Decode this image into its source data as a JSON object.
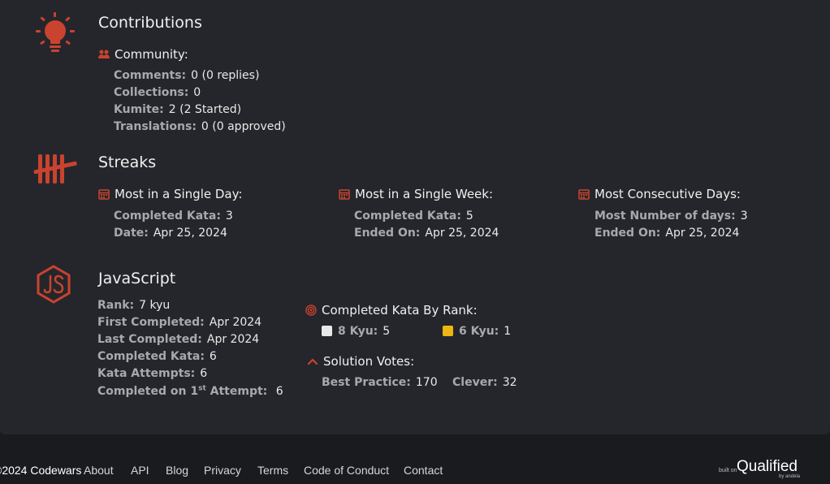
{
  "colors": {
    "accent": "#c9432f",
    "bg": "#25262b",
    "footer_bg": "#1a1b1e"
  },
  "contributions": {
    "title": "Contributions",
    "community_label": "Community:",
    "rows": [
      {
        "k": "Comments:",
        "v": "0 (0 replies)"
      },
      {
        "k": "Collections:",
        "v": "0"
      },
      {
        "k": "Kumite:",
        "v": "2 (2 Started)"
      },
      {
        "k": "Translations:",
        "v": "0 (0 approved)"
      }
    ]
  },
  "streaks": {
    "title": "Streaks",
    "day": {
      "label": "Most in a Single Day:",
      "rows": [
        {
          "k": "Completed Kata:",
          "v": "3"
        },
        {
          "k": "Date:",
          "v": "Apr 25, 2024"
        }
      ]
    },
    "week": {
      "label": "Most in a Single Week:",
      "rows": [
        {
          "k": "Completed Kata:",
          "v": "5"
        },
        {
          "k": "Ended On:",
          "v": "Apr 25, 2024"
        }
      ]
    },
    "consecutive": {
      "label": "Most Consecutive Days:",
      "rows": [
        {
          "k": "Most Number of days:",
          "v": "3"
        },
        {
          "k": "Ended On:",
          "v": "Apr 25, 2024"
        }
      ]
    }
  },
  "javascript": {
    "title": "JavaScript",
    "rows": [
      {
        "k": "Rank:",
        "v": "7 kyu"
      },
      {
        "k": "First Completed:",
        "v": "Apr 2024"
      },
      {
        "k": "Last Completed:",
        "v": "Apr 2024"
      },
      {
        "k": "Completed Kata:",
        "v": "6"
      },
      {
        "k": "Kata Attempts:",
        "v": "6"
      }
    ],
    "first_attempt": {
      "k_pre": "Completed on 1",
      "k_sup": "st",
      "k_post": " Attempt:",
      "v": "6"
    },
    "by_rank_label": "Completed Kata By Rank:",
    "ranks": [
      {
        "k": "8 Kyu:",
        "v": "5",
        "color": "#e8e8e8"
      },
      {
        "k": "6 Kyu:",
        "v": "1",
        "color": "#ecb613"
      }
    ],
    "votes_label": "Solution Votes:",
    "votes": [
      {
        "k": "Best Practice:",
        "v": "170"
      },
      {
        "k": "Clever:",
        "v": "32"
      }
    ]
  },
  "footer": {
    "copyright": "©2024 Codewars",
    "links": [
      "About",
      "API",
      "Blog",
      "Privacy",
      "Terms",
      "Code of Conduct",
      "Contact"
    ],
    "built_on": "built on",
    "qualified": "Qualified",
    "by": "by andela"
  }
}
